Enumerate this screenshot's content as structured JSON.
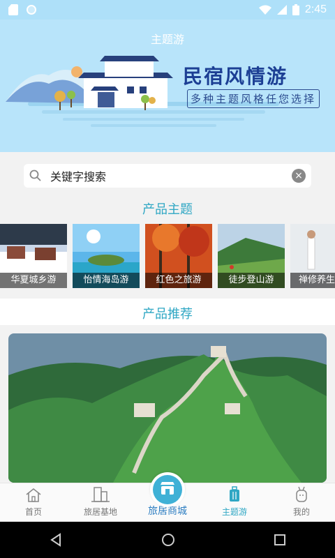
{
  "status_bar": {
    "time": "2:45"
  },
  "header": {
    "title": "主题游",
    "banner_title": "民宿风情游",
    "banner_subtitle": "多种主题风格任您选择"
  },
  "search": {
    "placeholder": "关键字搜索"
  },
  "sections": {
    "themes_title": "产品主题",
    "recommend_title": "产品推荐"
  },
  "themes": [
    {
      "label": "华夏城乡游"
    },
    {
      "label": "怡情海岛游"
    },
    {
      "label": "红色之旅游"
    },
    {
      "label": "徒步登山游"
    },
    {
      "label": "禅修养生"
    }
  ],
  "tabbar": {
    "home": "首页",
    "base": "旅居基地",
    "mall": "旅居商城",
    "theme": "主题游",
    "mine": "我的"
  },
  "colors": {
    "accent": "#2fa7c4",
    "header_bg": "#b8e4fa"
  }
}
